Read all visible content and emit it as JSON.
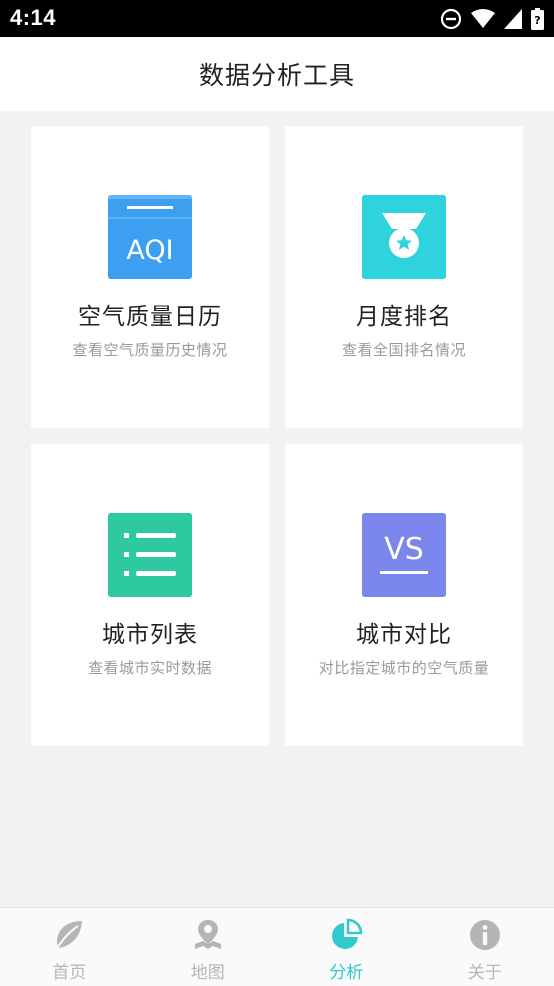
{
  "status_bar": {
    "time": "4:14"
  },
  "header": {
    "title": "数据分析工具"
  },
  "cards": [
    {
      "icon_name": "aqi-calendar-icon",
      "icon_text": "AQI",
      "title": "空气质量日历",
      "subtitle": "查看空气质量历史情况",
      "color": "#3d9ff0"
    },
    {
      "icon_name": "medal-icon",
      "title": "月度排名",
      "subtitle": "查看全国排名情况",
      "color": "#2fd3de"
    },
    {
      "icon_name": "list-icon",
      "title": "城市列表",
      "subtitle": "查看城市实时数据",
      "color": "#2ec9a0"
    },
    {
      "icon_name": "vs-icon",
      "icon_text": "VS",
      "title": "城市对比",
      "subtitle": "对比指定城市的空气质量",
      "color": "#7b86ec"
    }
  ],
  "tabs": [
    {
      "label": "首页",
      "icon_name": "leaf-icon",
      "active": false
    },
    {
      "label": "地图",
      "icon_name": "map-pin-icon",
      "active": false
    },
    {
      "label": "分析",
      "icon_name": "pie-chart-icon",
      "active": true
    },
    {
      "label": "关于",
      "icon_name": "info-icon",
      "active": false
    }
  ],
  "colors": {
    "accent": "#2fc9cf",
    "inactive": "#b5b5b5"
  }
}
